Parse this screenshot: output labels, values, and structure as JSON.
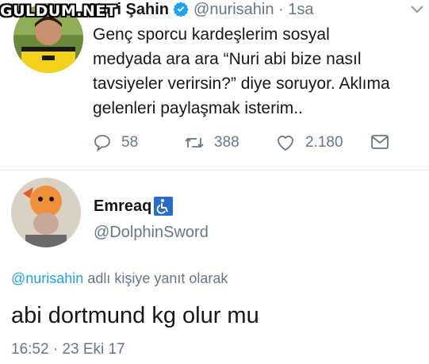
{
  "watermark": "GULDUM.NET",
  "tweet1": {
    "author_name": "Nuri Şahin",
    "handle": "@nurisahin",
    "separator": "·",
    "time": "1sa",
    "lines": [
      "Genç sporcu kardeşlerim sosyal",
      "medyada ara ara “Nuri abi bize nasıl",
      "tavsiyeler verirsin?” diye soruyor. Aklıma",
      "gelenleri paylaşmak isterim.."
    ],
    "replies": "58",
    "retweets": "388",
    "likes": "2.180",
    "icons": [
      "reply-icon",
      "retweet-icon",
      "like-icon",
      "dm-icon",
      "verified-icon",
      "chevron-down-icon"
    ]
  },
  "tweet2": {
    "author_name": "Emreaq",
    "handle": "@DolphinSword",
    "reply_context_link": "@nurisahin",
    "reply_context_text": " adlı kişiye yanıt olarak",
    "text": "abi dortmund kg olur mu",
    "timestamp": "16:52 · 23 Eki 17",
    "icons": [
      "accessibility-icon"
    ]
  },
  "colors": {
    "text": "#14171a",
    "muted": "#657786",
    "link": "#1da1f2",
    "verified": "#1da1f2",
    "badge": "#2b6cc4",
    "divider": "#e1e8ed"
  }
}
